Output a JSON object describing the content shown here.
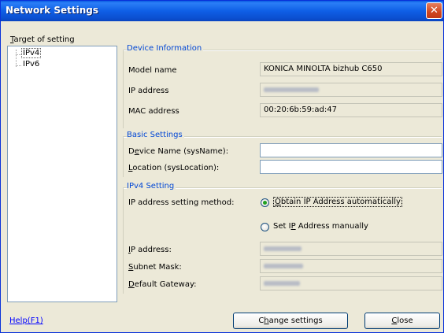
{
  "window": {
    "title": "Network Settings",
    "close_glyph": "✕"
  },
  "tree": {
    "label_prefix": "",
    "label_hotkey": "T",
    "label_rest": "arget of setting",
    "items": [
      "IPv4",
      "IPv6"
    ]
  },
  "device_info": {
    "group_title": "Device Information",
    "model_label": "Model name",
    "model_value": "KONICA MINOLTA bizhub C650",
    "ip_label": "IP address",
    "mac_label": "MAC address",
    "mac_value": "00:20:6b:59:ad:47"
  },
  "basic_settings": {
    "group_title": "Basic Settings",
    "device_name_label": {
      "pre": "D",
      "key": "e",
      "post": "vice Name (sysName):"
    },
    "device_name_value": "",
    "location_label": {
      "pre": "",
      "key": "L",
      "post": "ocation (sysLocation):"
    },
    "location_value": ""
  },
  "ipv4": {
    "group_title": "IPv4 Setting",
    "method_label": "IP address setting method:",
    "auto_option": {
      "pre": "",
      "key": "O",
      "post": "btain IP Address automatically",
      "selected": true
    },
    "manual_option": {
      "pre": "Set I",
      "key": "P",
      "post": " Address manually",
      "selected": false
    },
    "ip_label": {
      "pre": "",
      "key": "I",
      "post": "P address:"
    },
    "subnet_label": {
      "pre": "",
      "key": "S",
      "post": "ubnet Mask:"
    },
    "gateway_label": {
      "pre": "",
      "key": "D",
      "post": "efault Gateway:"
    }
  },
  "footer": {
    "help_link": "Help(F1)",
    "change_button": {
      "pre": "C",
      "key": "h",
      "post": "ange settings"
    },
    "close_button": {
      "pre": "",
      "key": "C",
      "post": "lose"
    }
  }
}
